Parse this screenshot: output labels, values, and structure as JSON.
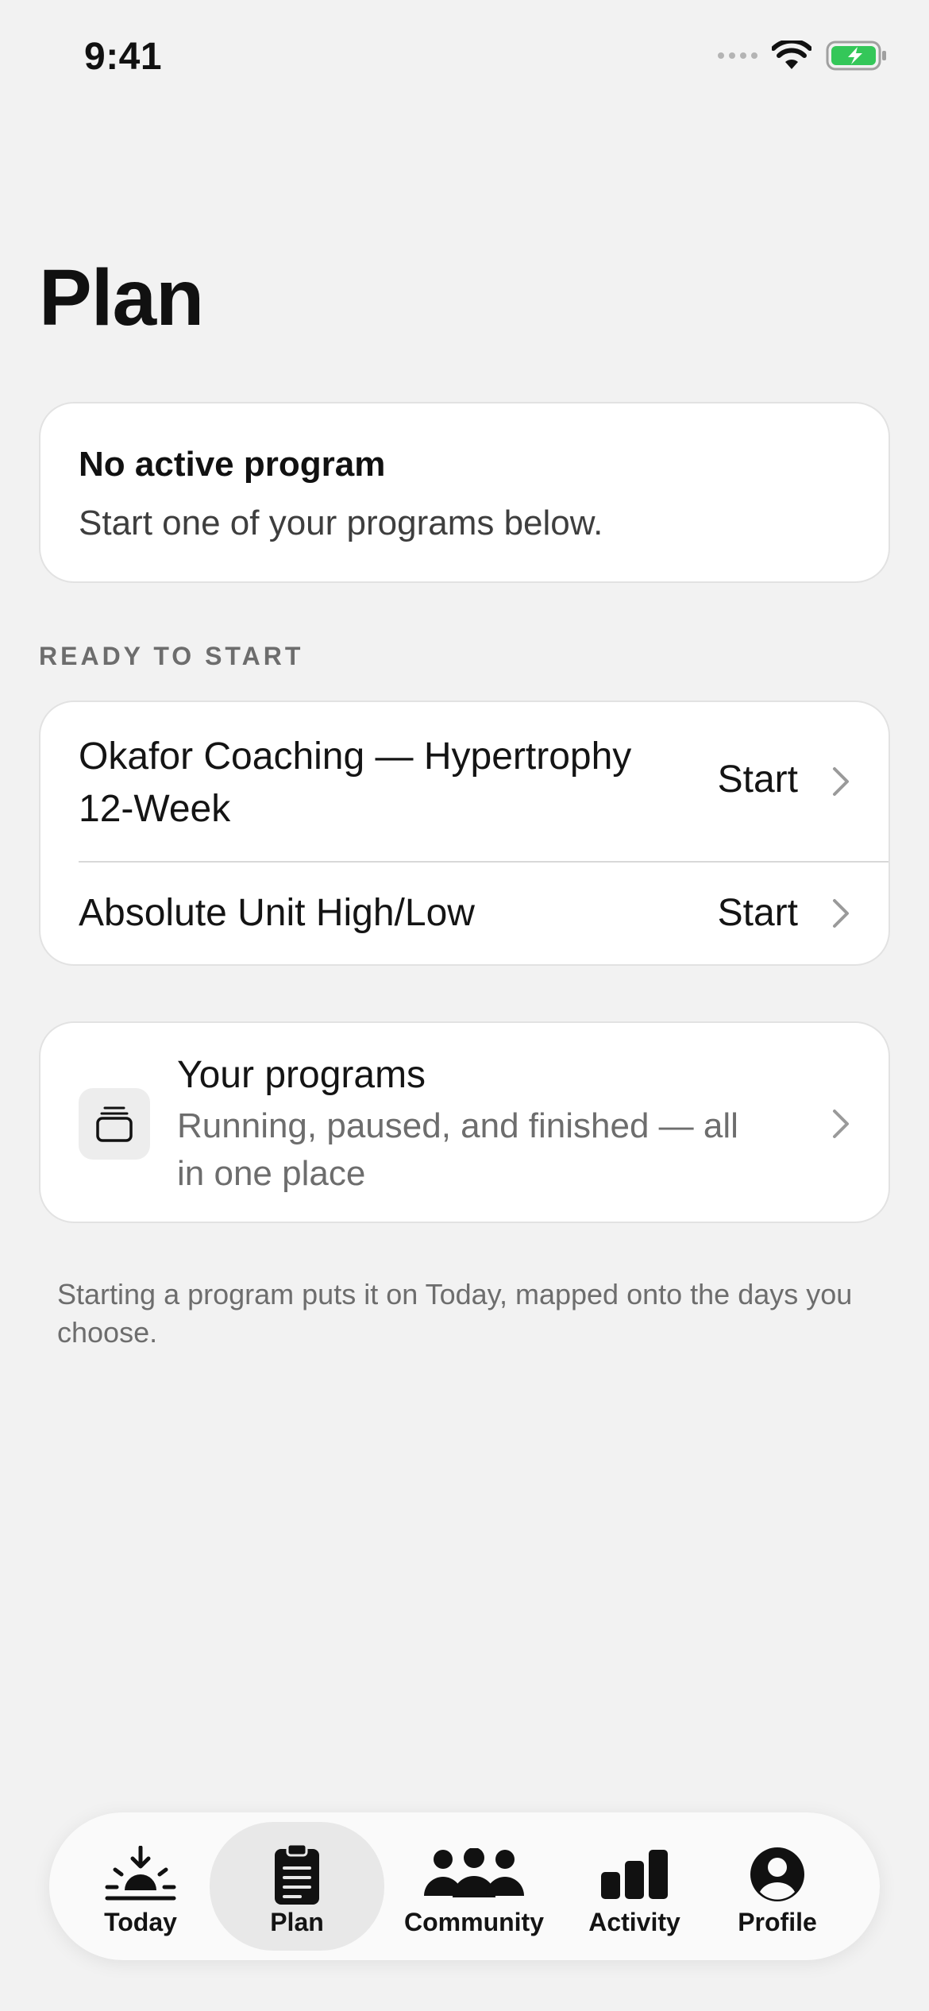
{
  "status": {
    "time": "9:41"
  },
  "page": {
    "title": "Plan"
  },
  "active_program": {
    "title": "No active program",
    "subtitle": "Start one of your programs below."
  },
  "ready_section": {
    "label": "READY TO START",
    "items": [
      {
        "title": "Okafor Coaching — Hypertrophy 12-Week",
        "action": "Start"
      },
      {
        "title": "Absolute Unit High/Low",
        "action": "Start"
      }
    ]
  },
  "your_programs": {
    "title": "Your programs",
    "subtitle": "Running, paused, and finished — all in one place"
  },
  "footnote": "Starting a program puts it on Today, mapped onto the days you choose.",
  "tabbar": {
    "active": "Plan",
    "tabs": [
      {
        "label": "Today",
        "icon": "sunrise-icon"
      },
      {
        "label": "Plan",
        "icon": "clipboard-icon"
      },
      {
        "label": "Community",
        "icon": "people-icon"
      },
      {
        "label": "Activity",
        "icon": "bar-chart-icon"
      },
      {
        "label": "Profile",
        "icon": "person-circle-icon"
      }
    ]
  },
  "colors": {
    "background": "#f2f2f2",
    "battery": "#34c759",
    "text": "#141414",
    "secondary": "#6d6d6d"
  }
}
